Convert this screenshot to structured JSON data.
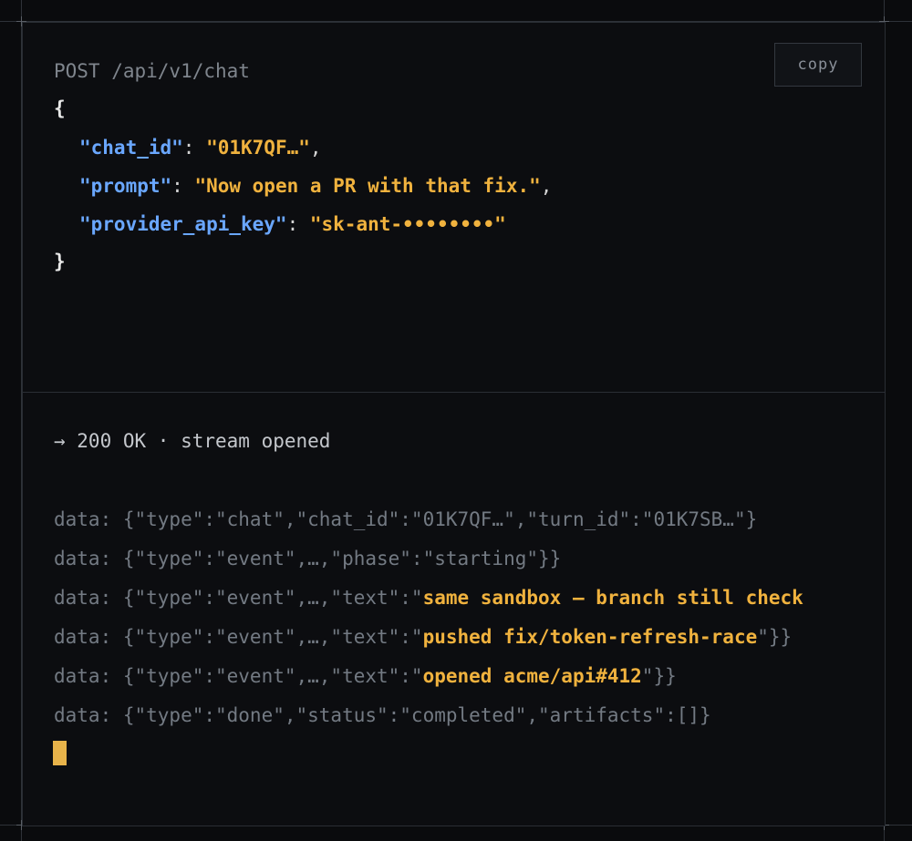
{
  "request": {
    "line": "POST /api/v1/chat",
    "open_brace": "{",
    "close_brace": "}",
    "fields": [
      {
        "key": "\"chat_id\"",
        "sep": ": ",
        "value": "\"01K7QF…\"",
        "trail": ","
      },
      {
        "key": "\"prompt\"",
        "sep": ": ",
        "value": "\"Now open a PR with that fix.\"",
        "trail": ","
      },
      {
        "key": "\"provider_api_key\"",
        "sep": ": ",
        "value": "\"sk-ant-••••••••\"",
        "trail": ""
      }
    ]
  },
  "copy_button": {
    "label": "copy"
  },
  "response": {
    "status": "→ 200 OK · stream opened",
    "events": [
      {
        "pre": "data: {\"type\":\"chat\",\"chat_id\":\"01K7QF…\",\"turn_id\":\"01K7SB…\"}",
        "hi": "",
        "post": ""
      },
      {
        "pre": "data: {\"type\":\"event\",…,\"phase\":\"starting\"}}",
        "hi": "",
        "post": ""
      },
      {
        "pre": "data: {\"type\":\"event\",…,\"text\":\"",
        "hi": "same sandbox — branch still check",
        "post": ""
      },
      {
        "pre": "data: {\"type\":\"event\",…,\"text\":\"",
        "hi": "pushed fix/token-refresh-race",
        "post": "\"}}"
      },
      {
        "pre": "data: {\"type\":\"event\",…,\"text\":\"",
        "hi": "opened acme/api#412",
        "post": "\"}}"
      },
      {
        "pre": "data: {\"type\":\"done\",\"status\":\"completed\",\"artifacts\":[]}",
        "hi": "",
        "post": ""
      }
    ]
  },
  "colors": {
    "background": "#0a0b0d",
    "key": "#6aa7ff",
    "string": "#f0b23e",
    "cursor": "#e8b34a"
  }
}
